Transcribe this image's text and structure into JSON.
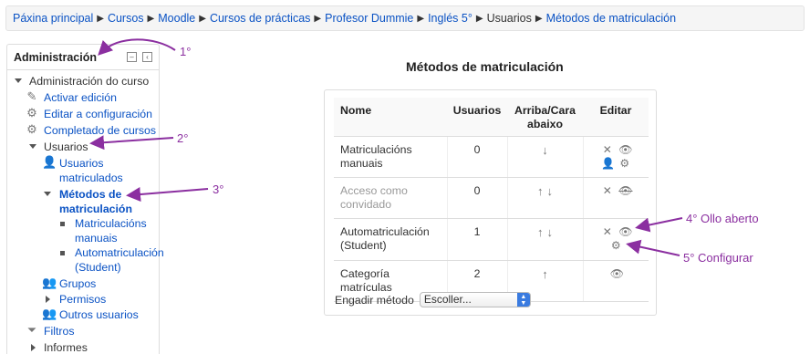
{
  "breadcrumb": [
    {
      "label": "Páxina principal",
      "link": true
    },
    {
      "label": "Cursos",
      "link": true
    },
    {
      "label": "Moodle",
      "link": true
    },
    {
      "label": "Cursos de prácticas",
      "link": true
    },
    {
      "label": "Profesor Dummie",
      "link": true
    },
    {
      "label": "Inglés 5°",
      "link": true
    },
    {
      "label": "Usuarios",
      "link": false
    },
    {
      "label": "Métodos de matriculación",
      "link": true
    }
  ],
  "admin_block": {
    "title": "Administración",
    "root": "Administración do curso",
    "activar_edicion": "Activar edición",
    "editar_configuracion": "Editar a configuración",
    "completado": "Completado de cursos",
    "usuarios": "Usuarios",
    "usuarios_matriculados_1": "Usuarios",
    "usuarios_matriculados_2": "matriculados",
    "metodos_1": "Métodos de",
    "metodos_2": "matriculación",
    "matric_manuais_1": "Matriculacións",
    "matric_manuais_2": "manuais",
    "automatric_1": "Automatriculación",
    "automatric_2": "(Student)",
    "grupos": "Grupos",
    "permisos": "Permisos",
    "outros_usuarios": "Outros usuarios",
    "filtros": "Filtros",
    "informes": "Informes"
  },
  "main": {
    "title": "Métodos de matriculación",
    "table_headers": {
      "nome": "Nome",
      "usuarios": "Usuarios",
      "arriba_1": "Arriba/Cara",
      "arriba_2": "abaixo",
      "editar": "Editar"
    },
    "rows": [
      {
        "name_1": "Matriculacións",
        "name_2": "manuais",
        "users": "0"
      },
      {
        "name_1": "Acceso como",
        "name_2": "convidado",
        "users": "0"
      },
      {
        "name_1": "Automatriculación",
        "name_2": "(Student)",
        "users": "1"
      },
      {
        "name_1": "Categoría matrículas",
        "name_2": "",
        "users": "2"
      }
    ],
    "engadir_label": "Engadir método",
    "engadir_value": "Escoller..."
  },
  "annotations": {
    "a1": "1°",
    "a2": "2°",
    "a3": "3°",
    "a4": "4° Ollo aberto",
    "a5": "5° Configurar"
  },
  "colors": {
    "link": "#0a52c4",
    "annotation": "#8b2fa0"
  }
}
